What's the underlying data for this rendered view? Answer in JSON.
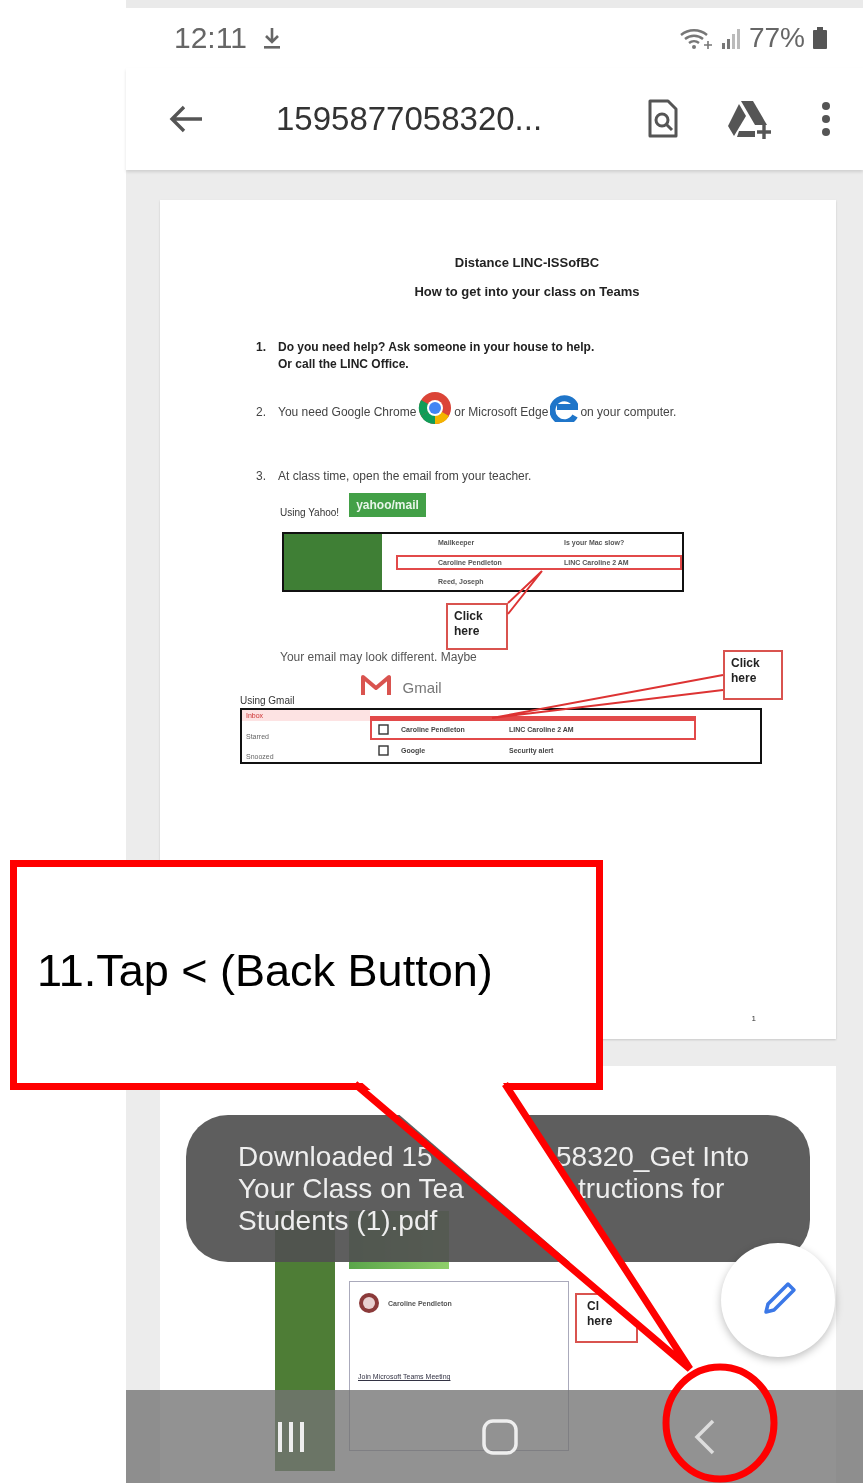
{
  "status_bar": {
    "time": "12:11",
    "battery": "77%"
  },
  "toolbar": {
    "title": "1595877058320..."
  },
  "page_1": {
    "title": "Distance LINC-ISSofBC",
    "subtitle": "How to get into your class on Teams",
    "steps": [
      {
        "number": "1.",
        "kind": "bold",
        "parts": [
          "Do you need help?  Ask someone in your house to help.\nOr call the LINC Office."
        ]
      },
      {
        "number": "2.",
        "kind": "icons",
        "parts": [
          "You need Google Chrome",
          "or Microsoft Edge",
          "on your computer."
        ]
      },
      {
        "number": "3.",
        "kind": "plain",
        "parts": [
          "At class time, open the email from your teacher."
        ]
      }
    ],
    "yahoo": {
      "label": "Using Yahoo!",
      "badge": "yahoo/mail",
      "callout": "Click\nhere",
      "rows": [
        {
          "sender": "Mailkeeper",
          "subject": "Is your Mac slow?",
          "highlighted": false
        },
        {
          "sender": "Caroline Pendleton",
          "subject": "LINC Caroline 2 AM",
          "highlighted": true
        },
        {
          "sender": "Reed, Joseph",
          "highlighted": false
        }
      ]
    },
    "note": "Your email may look different.  Maybe",
    "gmail": {
      "label": "Using Gmail",
      "logo_text": "Gmail",
      "callout": "Click\nhere",
      "folders": [
        {
          "name": "Inbox",
          "selected": true
        },
        {
          "name": "Starred",
          "selected": false
        },
        {
          "name": "Snoozed",
          "selected": false
        }
      ],
      "rows": [
        {
          "sender": "Caroline Pendleton",
          "subject": "LINC Caroline 2 AM",
          "highlighted": true
        },
        {
          "sender": "Google",
          "subject": "Security alert",
          "highlighted": false
        }
      ]
    },
    "page_number": "1"
  },
  "page_2": {
    "sender": "Caroline Pendleton",
    "link": "Join Microsoft Teams Meeting",
    "callout": "Cl\nhere"
  },
  "toast": {
    "lines": [
      [
        "Downloaded 15",
        "58320_Get Into"
      ],
      [
        "Your Class on Tea",
        "tructions for"
      ],
      [
        "Students (1).pdf"
      ]
    ]
  },
  "callout": {
    "text": "11.Tap < (Back Button)"
  }
}
